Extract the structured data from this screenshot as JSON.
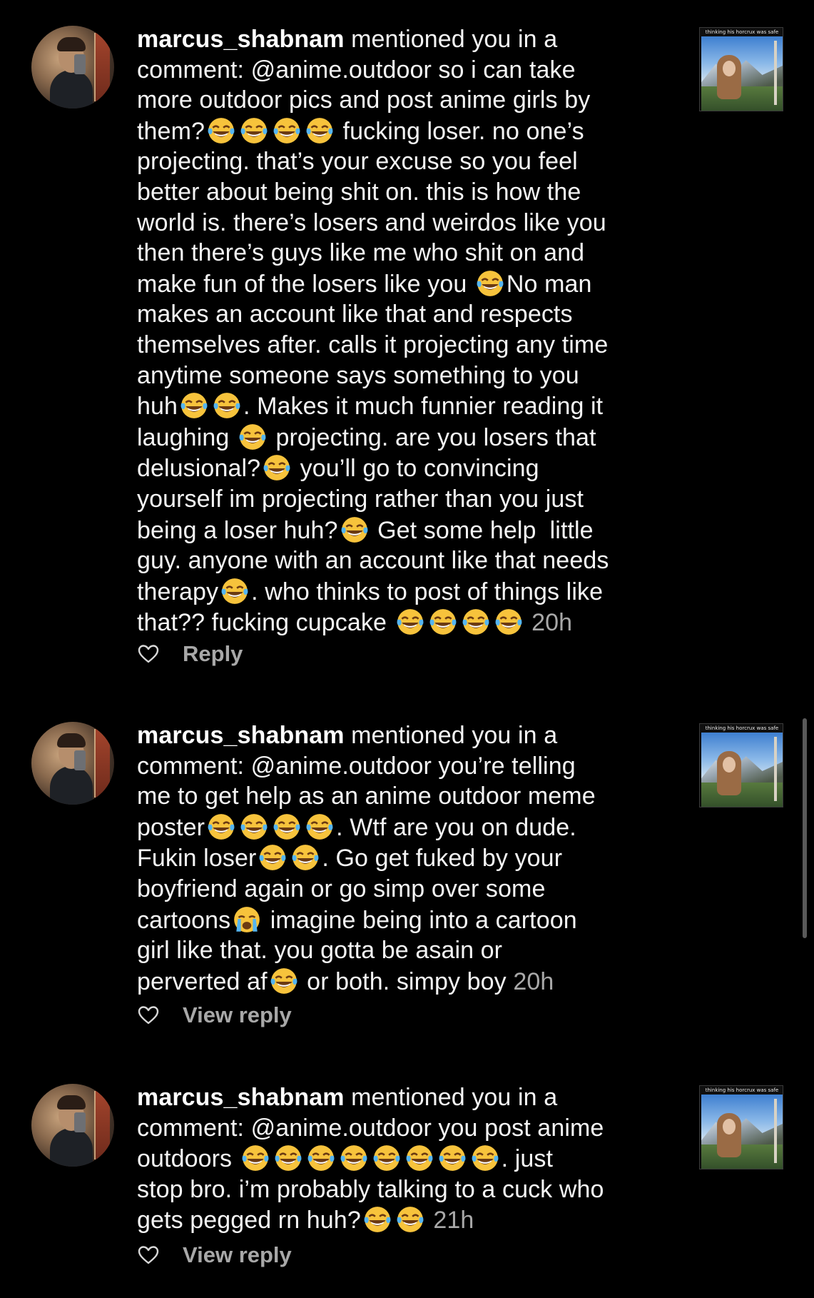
{
  "notifications": [
    {
      "username": "marcus_shabnam",
      "lines": [
        [
          {
            "t": "mentioned you in a",
            "s": " "
          }
        ],
        [
          {
            "t": "comment: @anime.outdoor so i can take"
          }
        ],
        [
          {
            "t": "more outdoor pics and post anime girls by"
          }
        ],
        [
          {
            "t": "them?"
          },
          {
            "e": 4
          },
          {
            "t": " fucking loser. no one’s"
          }
        ],
        [
          {
            "t": "projecting. that’s your excuse so you feel"
          }
        ],
        [
          {
            "t": "better about being shit on. this is how the"
          }
        ],
        [
          {
            "t": "world is. there’s losers and weirdos like you"
          }
        ],
        [
          {
            "t": "then there’s guys like me who shit on and"
          }
        ],
        [
          {
            "t": "make fun of the losers like you "
          },
          {
            "e": 1
          },
          {
            "t": "No man"
          }
        ],
        [
          {
            "t": "makes an account like that and respects"
          }
        ],
        [
          {
            "t": "themselves after. calls it projecting any time"
          }
        ],
        [
          {
            "t": "anytime someone says something to you"
          }
        ],
        [
          {
            "t": "huh"
          },
          {
            "e": 2
          },
          {
            "t": ". Makes it much funnier reading it"
          }
        ],
        [
          {
            "t": "laughing "
          },
          {
            "e": 1
          },
          {
            "t": " projecting. are you losers that"
          }
        ],
        [
          {
            "t": "delusional?"
          },
          {
            "e": 1
          },
          {
            "t": " you’ll go to convincing"
          }
        ],
        [
          {
            "t": "yourself im projecting rather than you just"
          }
        ],
        [
          {
            "t": "being a loser huh?"
          },
          {
            "e": 1
          },
          {
            "t": " Get some help  little"
          }
        ],
        [
          {
            "t": "guy. anyone with an account like that needs"
          }
        ],
        [
          {
            "t": "therapy"
          },
          {
            "e": 1
          },
          {
            "t": ". who thinks to post of things like"
          }
        ],
        [
          {
            "t": "that?? fucking cupcake "
          },
          {
            "e": 4
          },
          {
            "t": " "
          },
          {
            "time": "20h"
          }
        ]
      ],
      "action_label": "Reply"
    },
    {
      "username": "marcus_shabnam",
      "lines": [
        [
          {
            "t": "mentioned you in a",
            "s": " "
          }
        ],
        [
          {
            "t": "comment: @anime.outdoor you’re telling"
          }
        ],
        [
          {
            "t": "me to get help as an anime outdoor meme"
          }
        ],
        [
          {
            "t": "poster"
          },
          {
            "e": 4
          },
          {
            "t": ". Wtf are you on dude."
          }
        ],
        [
          {
            "t": "Fukin loser"
          },
          {
            "e": 2
          },
          {
            "t": ". Go get fuked by your"
          }
        ],
        [
          {
            "t": "boyfriend again or go simp over some"
          }
        ],
        [
          {
            "t": "cartoons"
          },
          {
            "e": 1,
            "cry": true
          },
          {
            "t": " imagine being into a cartoon"
          }
        ],
        [
          {
            "t": "girl like that. you gotta be asain or"
          }
        ],
        [
          {
            "t": "perverted af"
          },
          {
            "e": 1
          },
          {
            "t": " or both. simpy boy "
          },
          {
            "time": "20h"
          }
        ]
      ],
      "action_label": "View reply"
    },
    {
      "username": "marcus_shabnam",
      "lines": [
        [
          {
            "t": "mentioned you in a",
            "s": " "
          }
        ],
        [
          {
            "t": "comment: @anime.outdoor you post anime"
          }
        ],
        [
          {
            "t": "outdoors "
          },
          {
            "e": 8
          },
          {
            "t": ". just"
          }
        ],
        [
          {
            "t": "stop bro. i’m probably talking to a cuck who"
          }
        ],
        [
          {
            "t": "gets pegged rn huh?"
          },
          {
            "e": 2
          },
          {
            "t": " "
          },
          {
            "time": "21h"
          }
        ]
      ],
      "action_label": "View reply"
    }
  ],
  "thumbnail_caption": "thinking his horcrux was safe",
  "icons": {
    "avatar": "profile-photo",
    "emoji": "face-with-tears-of-joy",
    "cry_emoji": "loudly-crying-face",
    "like": "heart-outline-icon"
  },
  "colors": {
    "background": "#000000",
    "text": "#f5f5f5",
    "muted": "#a8a8a8",
    "emoji_yellow": "#f7c33c"
  }
}
